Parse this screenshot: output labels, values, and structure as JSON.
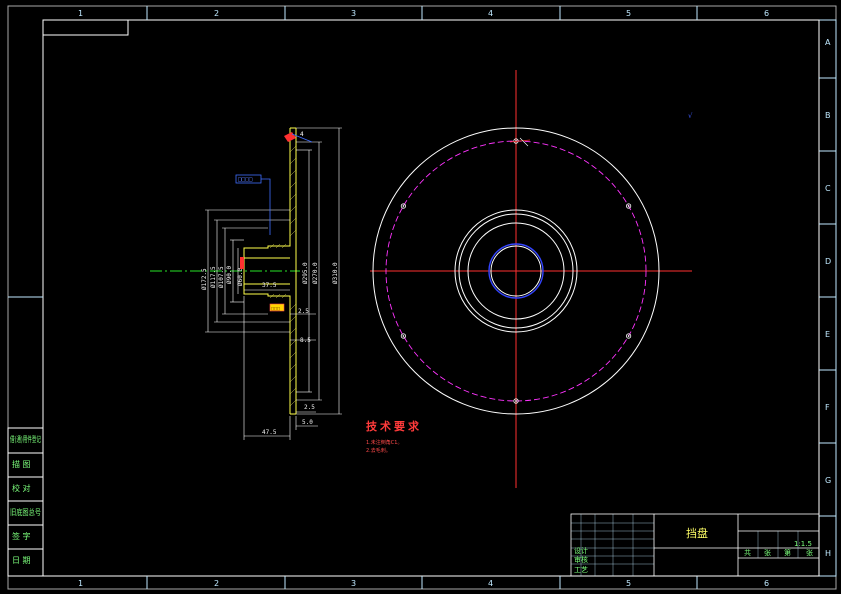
{
  "border": {
    "top_zones": [
      "1",
      "2",
      "3",
      "4",
      "5",
      "6"
    ],
    "bottom_zones": [
      "1",
      "2",
      "3",
      "4",
      "5",
      "6"
    ],
    "right_zones": [
      "A",
      "B",
      "C",
      "D",
      "E",
      "F",
      "G",
      "H"
    ]
  },
  "side_view": {
    "left_diameters": [
      "Ø172.5",
      "Ø117.5",
      "Ø107.5",
      "Ø90.0",
      "Ø60.0"
    ],
    "right_diameters": [
      "Ø295.0",
      "Ø270.0",
      "Ø310.0"
    ],
    "horizontal_dims": [
      "37.5",
      "2.5",
      "8.5",
      "2.5",
      "5.0",
      "47.5"
    ],
    "small_boxes": [
      "□□□□",
      "□□□"
    ],
    "red_mark": "",
    "blue_note": ""
  },
  "front_view": {
    "holes": 6,
    "note_text": "",
    "note_symbol": "√"
  },
  "technical_requirements": {
    "title": "技术要求",
    "lines": [
      "1.未注倒角C1。",
      "2.去毛刺。"
    ]
  },
  "side_table": {
    "rows": [
      "借(通)用件登记",
      "描  图",
      "校  对",
      "旧底图总号",
      "签  字",
      "日  期"
    ]
  },
  "title_block": {
    "part_name": "挡盘",
    "scale": "1:1.5",
    "left_labels": [
      "设计",
      "审核",
      "工艺"
    ],
    "right_labels": [
      "共",
      "张",
      "第",
      "张"
    ]
  }
}
